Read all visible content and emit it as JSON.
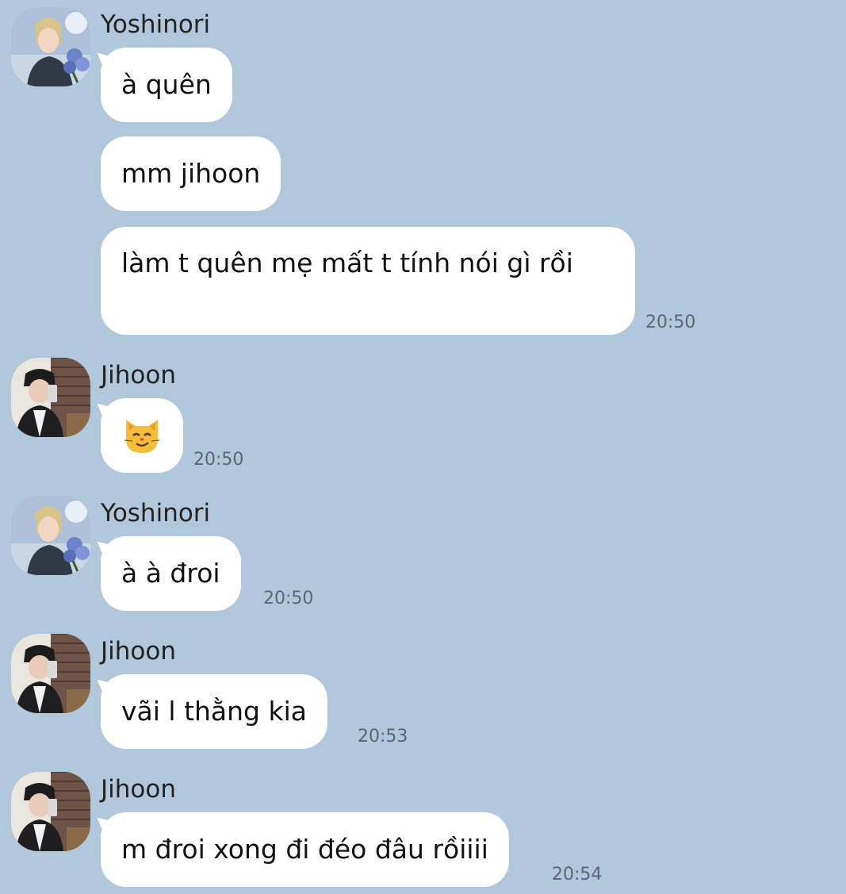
{
  "conversation": {
    "background_color": "#b1c7dc",
    "bubble_color": "#ffffff"
  },
  "groups": [
    {
      "sender": "Yoshinori",
      "avatar_icon": "yoshinori-avatar",
      "messages": [
        {
          "text": "à quên"
        },
        {
          "text": "mm jihoon"
        },
        {
          "text": "làm t quên mẹ mất t tính nói gì rồi",
          "time": "20:50"
        }
      ]
    },
    {
      "sender": "Jihoon",
      "avatar_icon": "jihoon-avatar",
      "messages": [
        {
          "emoji": "smirking-cat-emoji",
          "time": "20:50"
        }
      ]
    },
    {
      "sender": "Yoshinori",
      "avatar_icon": "yoshinori-avatar",
      "messages": [
        {
          "text": "à à đroi",
          "time": "20:50"
        }
      ]
    },
    {
      "sender": "Jihoon",
      "avatar_icon": "jihoon-avatar",
      "messages": [
        {
          "text": "vãi l thằng kia",
          "time": "20:53"
        }
      ]
    },
    {
      "sender": "Jihoon",
      "avatar_icon": "jihoon-avatar",
      "messages": [
        {
          "text": "m đroi xong đi đéo đâu rồiiii",
          "time": "20:54"
        }
      ]
    }
  ]
}
